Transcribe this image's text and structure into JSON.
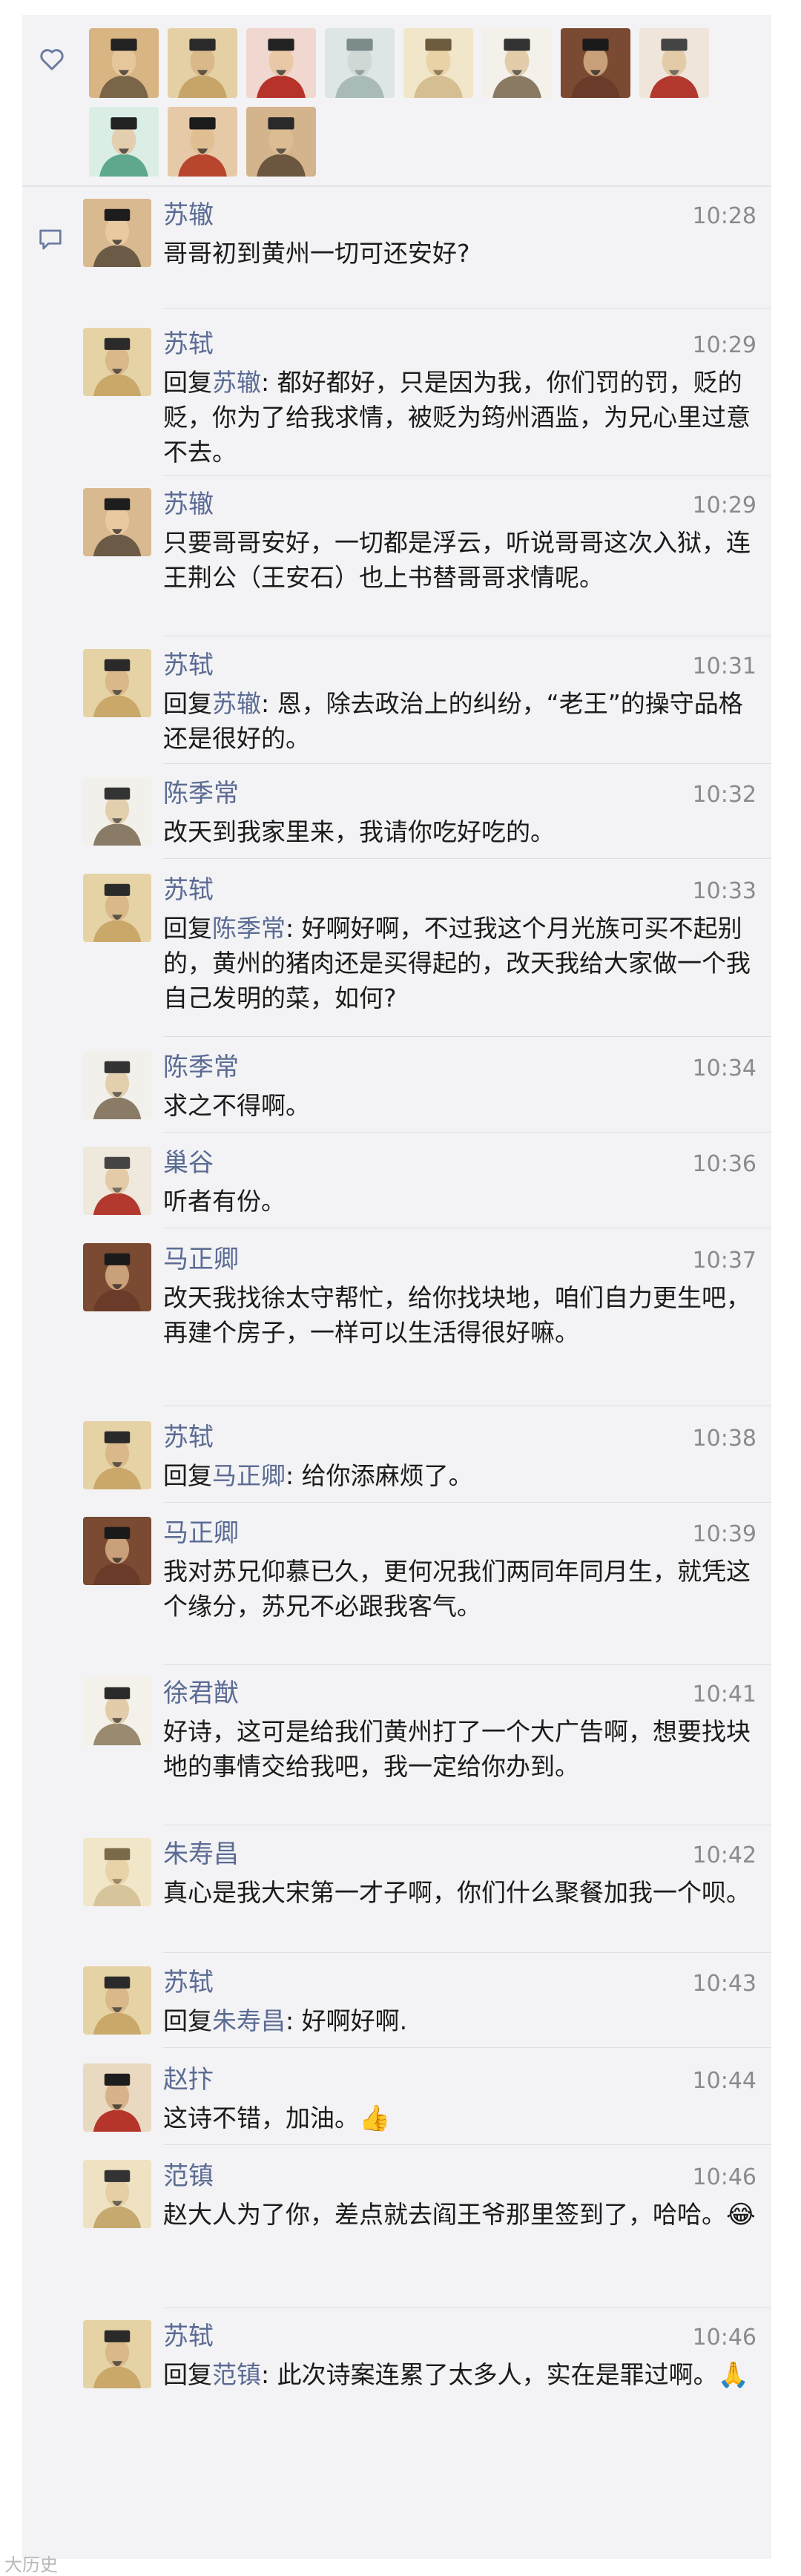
{
  "likes": {
    "icon": "heart-outline-icon",
    "avatars": [
      "portrait-scholar-1",
      "portrait-scholar-2",
      "portrait-official-red",
      "landscape-painting",
      "portrait-sketch",
      "portrait-seated-table",
      "portrait-official-brown",
      "portrait-red-robe",
      "portrait-green-robe",
      "portrait-black-hat",
      "portrait-dark-hat"
    ]
  },
  "comments": {
    "icon": "comment-bubble-icon",
    "items": [
      {
        "name": "苏辙",
        "time": "10:28",
        "reply_to": "",
        "text": "哥哥初到黄州一切可还安好?",
        "emoji": ""
      },
      {
        "name": "苏轼",
        "time": "10:29",
        "reply_to": "苏辙",
        "text": "都好都好，只是因为我，你们罚的罚，贬的贬，你为了给我求情，被贬为筠州酒监，为兄心里过意不去。",
        "emoji": ""
      },
      {
        "name": "苏辙",
        "time": "10:29",
        "reply_to": "",
        "text": "只要哥哥安好，一切都是浮云，听说哥哥这次入狱，连王荆公（王安石）也上书替哥哥求情呢。",
        "emoji": ""
      },
      {
        "name": "苏轼",
        "time": "10:31",
        "reply_to": "苏辙",
        "text": "恩，除去政治上的纠纷，“老王”的操守品格还是很好的。",
        "emoji": ""
      },
      {
        "name": "陈季常",
        "time": "10:32",
        "reply_to": "",
        "text": "改天到我家里来，我请你吃好吃的。",
        "emoji": ""
      },
      {
        "name": "苏轼",
        "time": "10:33",
        "reply_to": "陈季常",
        "text": "好啊好啊，不过我这个月光族可买不起别的，黄州的猪肉还是买得起的，改天我给大家做一个我自己发明的菜，如何?",
        "emoji": ""
      },
      {
        "name": "陈季常",
        "time": "10:34",
        "reply_to": "",
        "text": "求之不得啊。",
        "emoji": ""
      },
      {
        "name": "巢谷",
        "time": "10:36",
        "reply_to": "",
        "text": "听者有份。",
        "emoji": ""
      },
      {
        "name": "马正卿",
        "time": "10:37",
        "reply_to": "",
        "text": "改天我找徐太守帮忙，给你找块地，咱们自力更生吧，再建个房子，一样可以生活得很好嘛。",
        "emoji": ""
      },
      {
        "name": "苏轼",
        "time": "10:38",
        "reply_to": "马正卿",
        "text": "给你添麻烦了。",
        "emoji": ""
      },
      {
        "name": "马正卿",
        "time": "10:39",
        "reply_to": "",
        "text": "我对苏兄仰慕已久，更何况我们两同年同月生，就凭这个缘分，苏兄不必跟我客气。",
        "emoji": ""
      },
      {
        "name": "徐君猷",
        "time": "10:41",
        "reply_to": "",
        "text": "好诗，这可是给我们黄州打了一个大广告啊，想要找块地的事情交给我吧，我一定给你办到。",
        "emoji": ""
      },
      {
        "name": "朱寿昌",
        "time": "10:42",
        "reply_to": "",
        "text": "真心是我大宋第一才子啊，你们什么聚餐加我一个呗。",
        "emoji": ""
      },
      {
        "name": "苏轼",
        "time": "10:43",
        "reply_to": "朱寿昌",
        "text": "好啊好啊.",
        "emoji": ""
      },
      {
        "name": "赵抃",
        "time": "10:44",
        "reply_to": "",
        "text": "这诗不错，加油。",
        "emoji": "👍"
      },
      {
        "name": "范镇",
        "time": "10:46",
        "reply_to": "",
        "text": "赵大人为了你，差点就去阎王爷那里签到了，哈哈。",
        "emoji": "😂"
      },
      {
        "name": "苏轼",
        "time": "10:46",
        "reply_to": "范镇",
        "text": "此次诗案连累了太多人，实在是罪过啊。",
        "emoji": "🙏"
      }
    ]
  },
  "labels": {
    "reply_prefix": "回复",
    "reply_colon": ": "
  },
  "watermark": "大历史"
}
